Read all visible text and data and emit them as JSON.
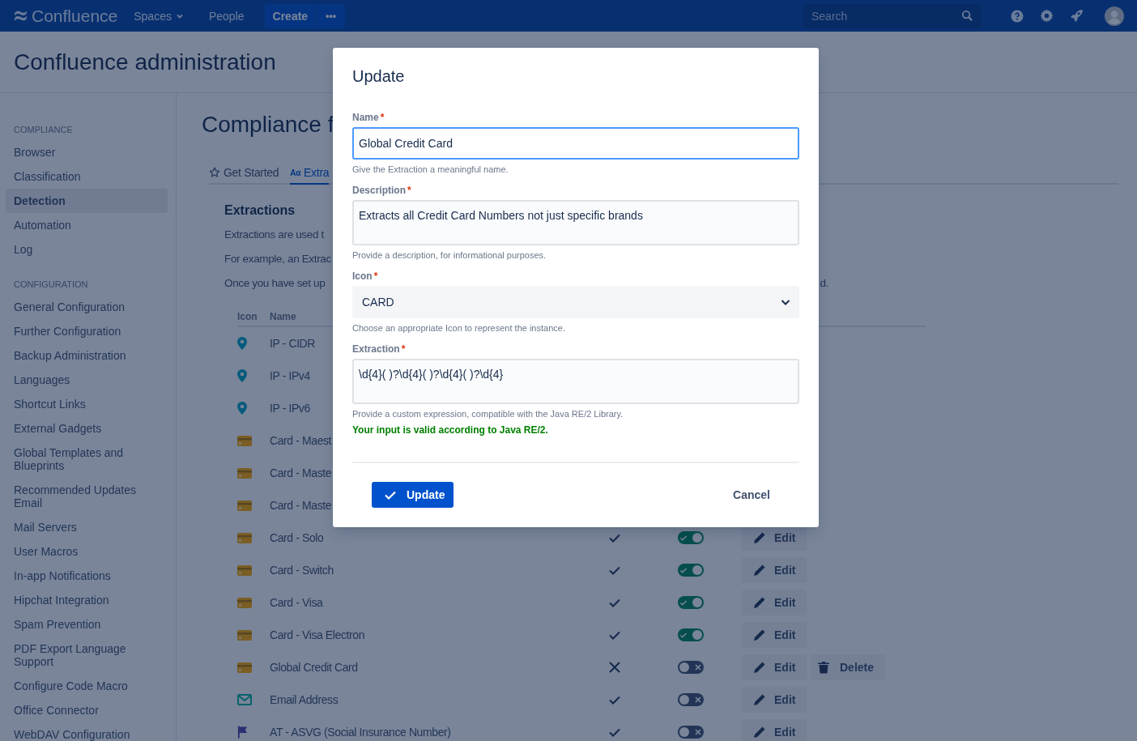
{
  "top_bar": {
    "product": "Confluence",
    "nav": [
      {
        "label": "Spaces",
        "dropdown": true
      },
      {
        "label": "People",
        "dropdown": false
      }
    ],
    "create": "Create",
    "more": "•••",
    "search": {
      "placeholder": "Search"
    }
  },
  "page_title": "Confluence administration",
  "sidebar": {
    "sections": [
      {
        "heading": "COMPLIANCE",
        "items": [
          {
            "label": "Browser",
            "selected": false
          },
          {
            "label": "Classification",
            "selected": false
          },
          {
            "label": "Detection",
            "selected": true
          },
          {
            "label": "Automation",
            "selected": false
          },
          {
            "label": "Log",
            "selected": false
          }
        ]
      },
      {
        "heading": "CONFIGURATION",
        "items": [
          {
            "label": "General Configuration",
            "selected": false
          },
          {
            "label": "Further Configuration",
            "selected": false
          },
          {
            "label": "Backup Administration",
            "selected": false
          },
          {
            "label": "Languages",
            "selected": false
          },
          {
            "label": "Shortcut Links",
            "selected": false
          },
          {
            "label": "External Gadgets",
            "selected": false
          },
          {
            "label": "Global Templates and Blueprints",
            "selected": false
          },
          {
            "label": "Recommended Updates Email",
            "selected": false
          },
          {
            "label": "Mail Servers",
            "selected": false
          },
          {
            "label": "User Macros",
            "selected": false
          },
          {
            "label": "In-app Notifications",
            "selected": false
          },
          {
            "label": "Hipchat Integration",
            "selected": false
          },
          {
            "label": "Spam Prevention",
            "selected": false
          },
          {
            "label": "PDF Export Language Support",
            "selected": false
          },
          {
            "label": "Configure Code Macro",
            "selected": false
          },
          {
            "label": "Office Connector",
            "selected": false
          },
          {
            "label": "WebDAV Configuration",
            "selected": false
          }
        ]
      }
    ]
  },
  "content": {
    "title": "Compliance f",
    "tabs": [
      {
        "kind": "star",
        "label": "Get Started",
        "selected": false
      },
      {
        "kind": "glyph",
        "glyph": "Aα",
        "label": "Extra",
        "selected": true
      }
    ],
    "section_title": "Extractions",
    "paragraphs": [
      {
        "text": "Extractions are used t"
      },
      {
        "text": "For example, an Extrac"
      },
      {
        "text": "Once you have set up",
        "tail": "d."
      }
    ],
    "table": {
      "columns": [
        "Icon",
        "Name"
      ],
      "rows": [
        {
          "kind": "pin",
          "name": "IP - CIDR"
        },
        {
          "kind": "pin",
          "name": "IP - IPv4"
        },
        {
          "kind": "pin",
          "name": "IP - IPv6"
        },
        {
          "kind": "card",
          "name": "Card - Maest"
        },
        {
          "kind": "card",
          "name": "Card - Maste"
        },
        {
          "kind": "card",
          "name": "Card - Maste"
        },
        {
          "kind": "card",
          "name": "Card - Solo",
          "valid": true,
          "enabled": true,
          "edit": "Edit"
        },
        {
          "kind": "card",
          "name": "Card - Switch",
          "valid": true,
          "enabled": true,
          "edit": "Edit"
        },
        {
          "kind": "card",
          "name": "Card - Visa",
          "valid": true,
          "enabled": true,
          "edit": "Edit"
        },
        {
          "kind": "card",
          "name": "Card - Visa Electron",
          "valid": true,
          "enabled": true,
          "edit": "Edit"
        },
        {
          "kind": "card",
          "name": "Global Credit Card",
          "valid": false,
          "enabled": false,
          "edit": "Edit",
          "delete": "Delete"
        },
        {
          "kind": "mail",
          "name": "Email Address",
          "valid": true,
          "enabled": false,
          "edit": "Edit"
        },
        {
          "kind": "flag",
          "name": "AT - ASVG (Social Insurance Number)",
          "valid": true,
          "enabled": false,
          "edit": "Edit"
        }
      ]
    }
  },
  "dialog": {
    "title": "Update",
    "fields": [
      {
        "kind": "text",
        "label": "Name",
        "required_mark": "*",
        "value": "Global Credit Card",
        "focused": true,
        "help": "Give the Extraction a meaningful name."
      },
      {
        "kind": "textarea",
        "label": "Description",
        "required_mark": "*",
        "value": "Extracts all Credit Card Numbers not just specific brands",
        "focused": false,
        "help": "Provide a description, for informational purposes."
      },
      {
        "kind": "select",
        "label": "Icon",
        "required_mark": "*",
        "value": "CARD",
        "focused": false,
        "help": "Choose an appropriate Icon to represent the instance."
      },
      {
        "kind": "textarea",
        "label": "Extraction",
        "required_mark": "*",
        "value": "\\d{4}( )?\\d{4}( )?\\d{4}( )?\\d{4}",
        "focused": false,
        "help": "Provide a custom expression, compatible with the Java RE/2 Library.",
        "validation": "Your input is valid according to Java RE/2."
      }
    ],
    "primary": "Update",
    "cancel": "Cancel"
  }
}
